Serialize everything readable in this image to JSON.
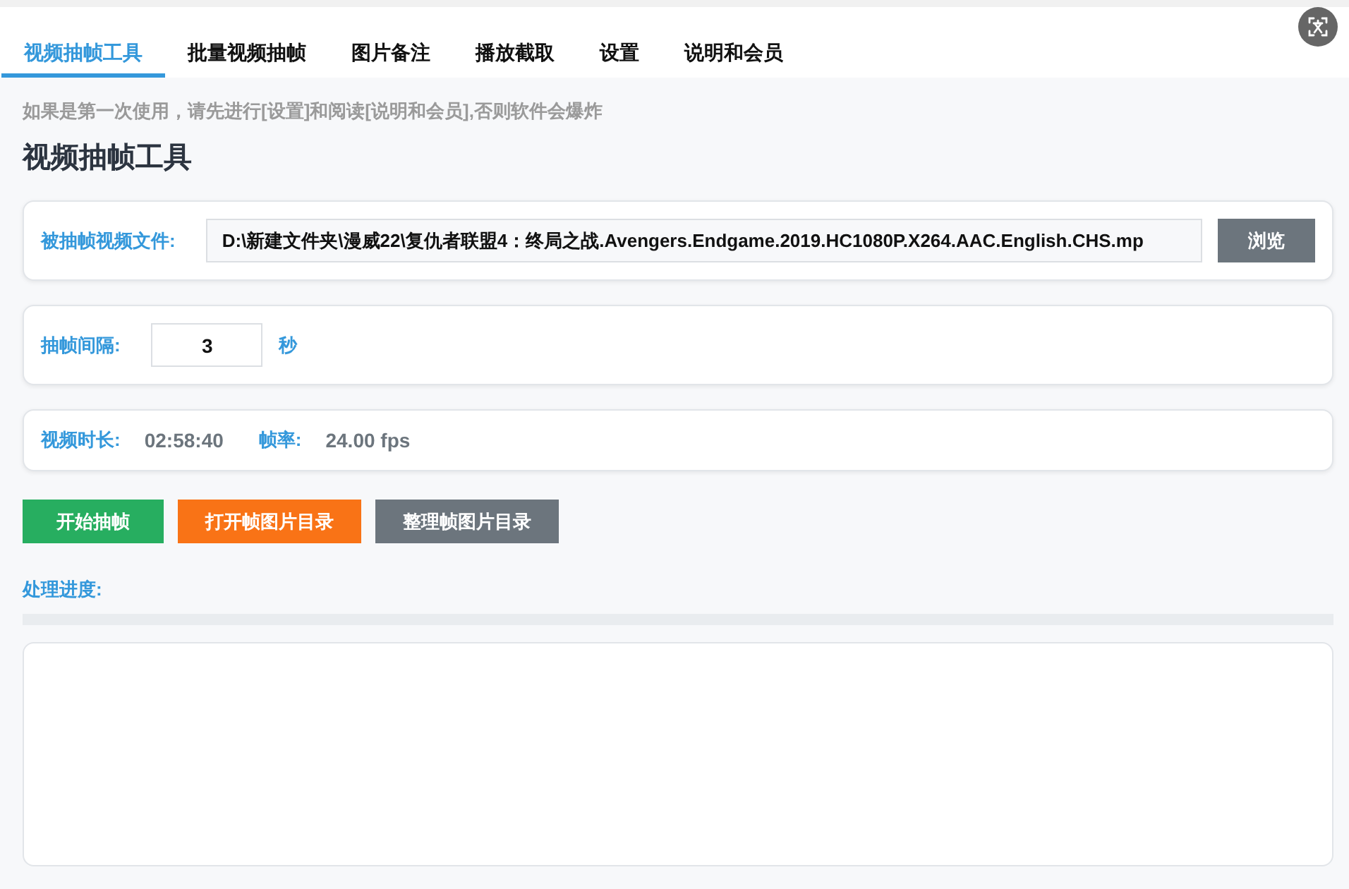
{
  "tabs": [
    {
      "label": "视频抽帧工具",
      "selected": true
    },
    {
      "label": "批量视频抽帧",
      "selected": false
    },
    {
      "label": "图片备注",
      "selected": false
    },
    {
      "label": "播放截取",
      "selected": false
    },
    {
      "label": "设置",
      "selected": false
    },
    {
      "label": "说明和会员",
      "selected": false
    }
  ],
  "notice": "如果是第一次使用，请先进行[设置]和阅读[说明和会员],否则软件会爆炸",
  "heading": "视频抽帧工具",
  "file_row": {
    "label": "被抽帧视频文件:",
    "value": "D:\\新建文件夹\\漫威22\\复仇者联盟4：终局之战.Avengers.Endgame.2019.HC1080P.X264.AAC.English.CHS.mp",
    "button": "浏览"
  },
  "interval_row": {
    "label": "抽帧间隔:",
    "value": "3",
    "unit": "秒"
  },
  "info_row": [
    {
      "label": "视频时长:",
      "value": "02:58:40"
    },
    {
      "label": "帧率:",
      "value": "24.00 fps"
    }
  ],
  "actions": [
    {
      "label": "开始抽帧",
      "kind": "start"
    },
    {
      "label": "打开帧图片目录",
      "kind": "open"
    },
    {
      "label": "整理帧图片目录",
      "kind": "organize"
    }
  ],
  "progress": {
    "label": "处理进度:"
  }
}
